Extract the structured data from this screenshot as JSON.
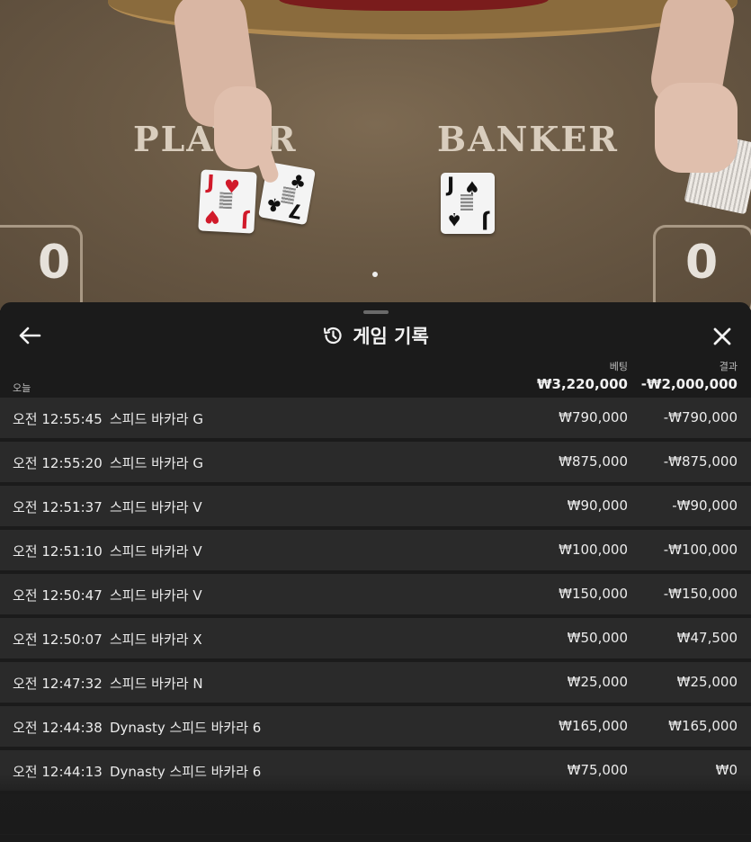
{
  "table": {
    "player_label": "PLAYER",
    "banker_label": "BANKER",
    "player_score": "0",
    "banker_score": "0",
    "player_cards": [
      {
        "rank": "J",
        "suit": "♥",
        "color": "#d11a2a"
      },
      {
        "rank": "7",
        "suit": "♣",
        "color": "#111111"
      }
    ],
    "banker_cards": [
      {
        "rank": "J",
        "suit": "♠",
        "color": "#111111"
      }
    ]
  },
  "panel": {
    "title": "게임 기록",
    "back_icon": "arrow-left-icon",
    "close_icon": "close-icon",
    "title_icon": "history-icon",
    "date_label": "오늘",
    "columns": {
      "bet": "베팅",
      "result": "결과"
    },
    "totals": {
      "bet": "₩3,220,000",
      "result": "-₩2,000,000"
    },
    "rows": [
      {
        "time": "오전 12:55:45",
        "game": "스피드 바카라 G",
        "bet": "₩790,000",
        "result": "-₩790,000"
      },
      {
        "time": "오전 12:55:20",
        "game": "스피드 바카라 G",
        "bet": "₩875,000",
        "result": "-₩875,000"
      },
      {
        "time": "오전 12:51:37",
        "game": "스피드 바카라 V",
        "bet": "₩90,000",
        "result": "-₩90,000"
      },
      {
        "time": "오전 12:51:10",
        "game": "스피드 바카라 V",
        "bet": "₩100,000",
        "result": "-₩100,000"
      },
      {
        "time": "오전 12:50:47",
        "game": "스피드 바카라 V",
        "bet": "₩150,000",
        "result": "-₩150,000"
      },
      {
        "time": "오전 12:50:07",
        "game": "스피드 바카라 X",
        "bet": "₩50,000",
        "result": "₩47,500"
      },
      {
        "time": "오전 12:47:32",
        "game": "스피드 바카라 N",
        "bet": "₩25,000",
        "result": "₩25,000"
      },
      {
        "time": "오전 12:44:38",
        "game": "Dynasty 스피드 바카라 6",
        "bet": "₩165,000",
        "result": "₩165,000"
      },
      {
        "time": "오전 12:44:13",
        "game": "Dynasty 스피드 바카라 6",
        "bet": "₩75,000",
        "result": "₩0"
      }
    ]
  }
}
